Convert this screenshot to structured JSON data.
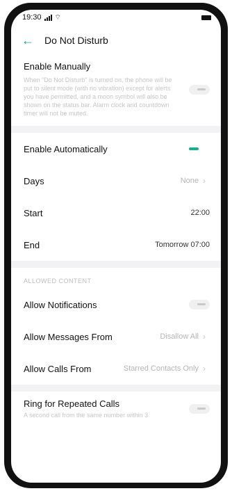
{
  "status_bar": {
    "time": "19:30",
    "signal": "📶",
    "wifi": "wifi"
  },
  "header": {
    "title": "Do Not Disturb"
  },
  "enable_manually": {
    "label": "Enable Manually",
    "description": "When \"Do Not Disturb\" is turned on, the phone will be put to silent mode (with no vibration) except for alerts you have permitted, and a moon symbol will also be shown on the status bar. Alarm clock and countdown timer will not be muted."
  },
  "auto": {
    "enable_label": "Enable Automatically",
    "days_label": "Days",
    "days_value": "None",
    "start_label": "Start",
    "start_value": "22:00",
    "end_label": "End",
    "end_value": "Tomorrow 07:00"
  },
  "allowed": {
    "section_label": "ALLOWED CONTENT",
    "notifications_label": "Allow Notifications",
    "messages_label": "Allow Messages From",
    "messages_value": "Disallow All",
    "calls_label": "Allow Calls From",
    "calls_value": "Starred Contacts Only"
  },
  "repeated": {
    "label": "Ring for Repeated Calls",
    "description": "A second call from the same number within 3"
  },
  "colors": {
    "accent": "#12b28a",
    "muted": "#c6c6c6"
  }
}
